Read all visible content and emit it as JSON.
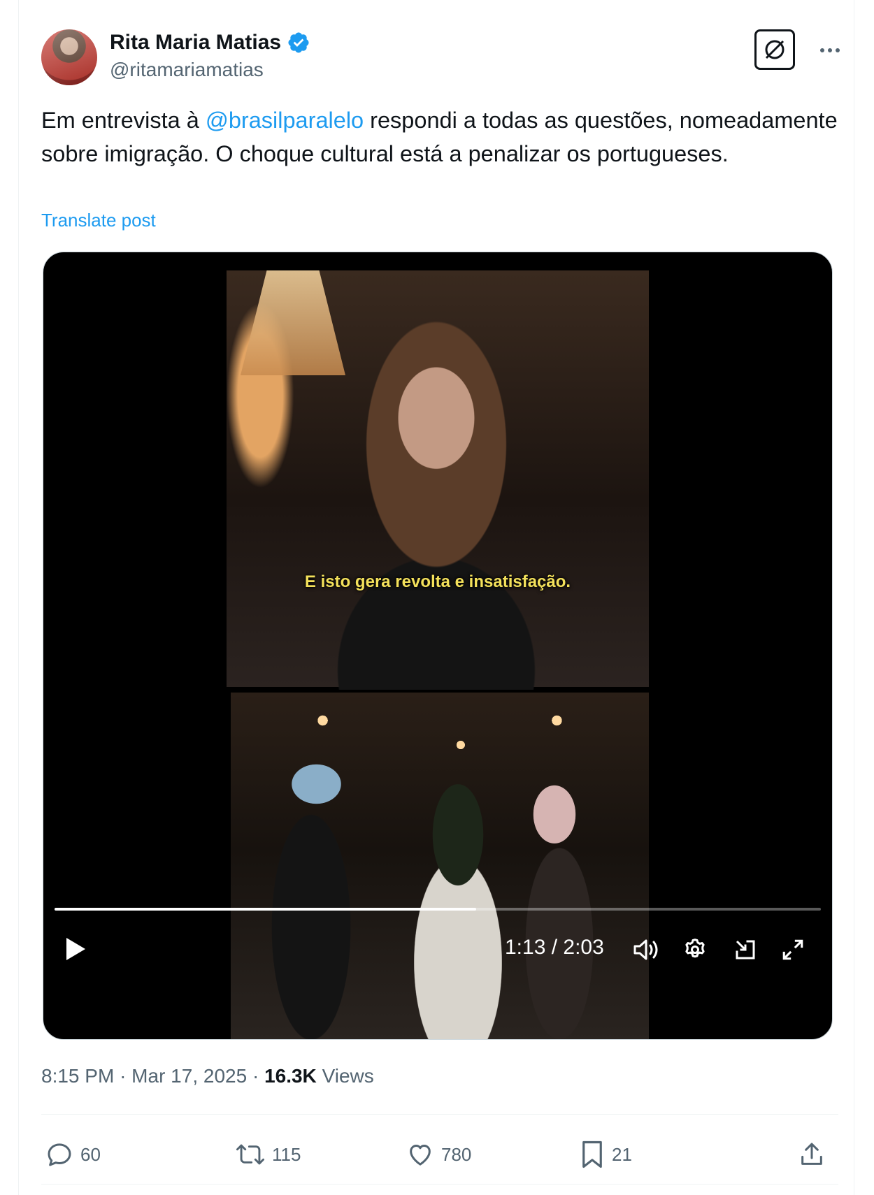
{
  "author": {
    "name": "Rita Maria Matias",
    "handle": "@ritamariamatias",
    "verified": true
  },
  "post": {
    "text_before_mention": "Em entrevista à ",
    "mention": "@brasilparalelo",
    "text_after_mention": " respondi a todas as questões, nomeadamente sobre imigração. O choque cultural está a penalizar os portugueses.",
    "translate_label": "Translate post"
  },
  "video": {
    "caption": "E isto gera revolta e insatisfação.",
    "time_display": "1:13 / 2:03",
    "progress_fraction": 0.55
  },
  "meta": {
    "time": "8:15 PM",
    "date": "Mar 17, 2025",
    "views_count": "16.3K",
    "views_label": "Views",
    "separator": "·"
  },
  "actions": {
    "replies": "60",
    "reposts": "115",
    "likes": "780",
    "bookmarks": "21"
  },
  "colors": {
    "accent": "#1d9bf0",
    "text_primary": "#0f1419",
    "text_secondary": "#536471",
    "caption_yellow": "#f4e15b"
  },
  "icons": {
    "verified": "verified-badge-icon",
    "grok": "grok-icon",
    "more": "more-horizontal-icon",
    "play": "play-icon",
    "volume": "volume-icon",
    "settings": "gear-icon",
    "pip": "pip-icon",
    "fullscreen": "fullscreen-icon",
    "reply": "reply-icon",
    "repost": "repost-icon",
    "like": "heart-icon",
    "bookmark": "bookmark-icon",
    "share": "share-icon"
  }
}
